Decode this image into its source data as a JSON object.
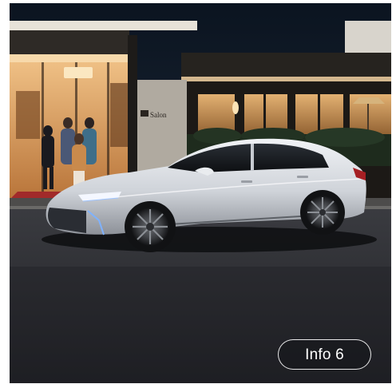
{
  "card": {
    "info_button_label": "Info 6"
  },
  "scene": {
    "storefront_sign": "Salon"
  },
  "colors": {
    "night_sky": "#0e1722",
    "building_warm_light": "#e9a65a",
    "car_body": "#d9dde2",
    "road": "#2a2b2f"
  },
  "icons": {
    "photo_subject": "car-photo"
  }
}
